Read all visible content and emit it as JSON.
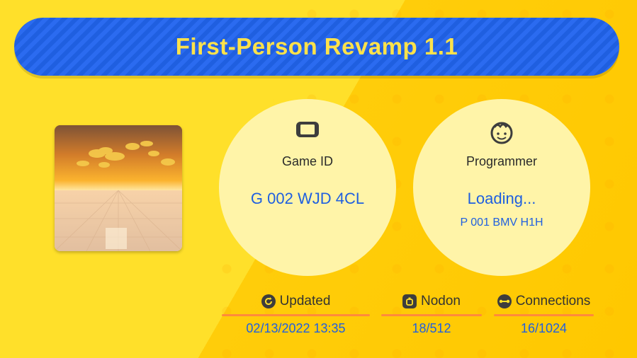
{
  "title": "First-Person Revamp 1.1",
  "game_id": {
    "label": "Game ID",
    "value": "G 002 WJD 4CL",
    "icon": "switch-console-icon"
  },
  "programmer": {
    "label": "Programmer",
    "name": "Loading...",
    "id": "P 001 BMV H1H",
    "icon": "smiley-face-icon"
  },
  "stats": {
    "updated": {
      "label": "Updated",
      "value": "02/13/2022 13:35",
      "icon": "refresh-icon"
    },
    "nodon": {
      "label": "Nodon",
      "value": "18/512",
      "icon": "nodon-icon"
    },
    "connections": {
      "label": "Connections",
      "value": "16/1024",
      "icon": "connection-icon"
    }
  },
  "colors": {
    "background": "#FFD60A",
    "banner": "#1F5FE0",
    "title_text": "#FFE24A",
    "circle_fill": "#FFF4A8",
    "value_text": "#1F5FE0",
    "underline": "#FF8A3C"
  }
}
